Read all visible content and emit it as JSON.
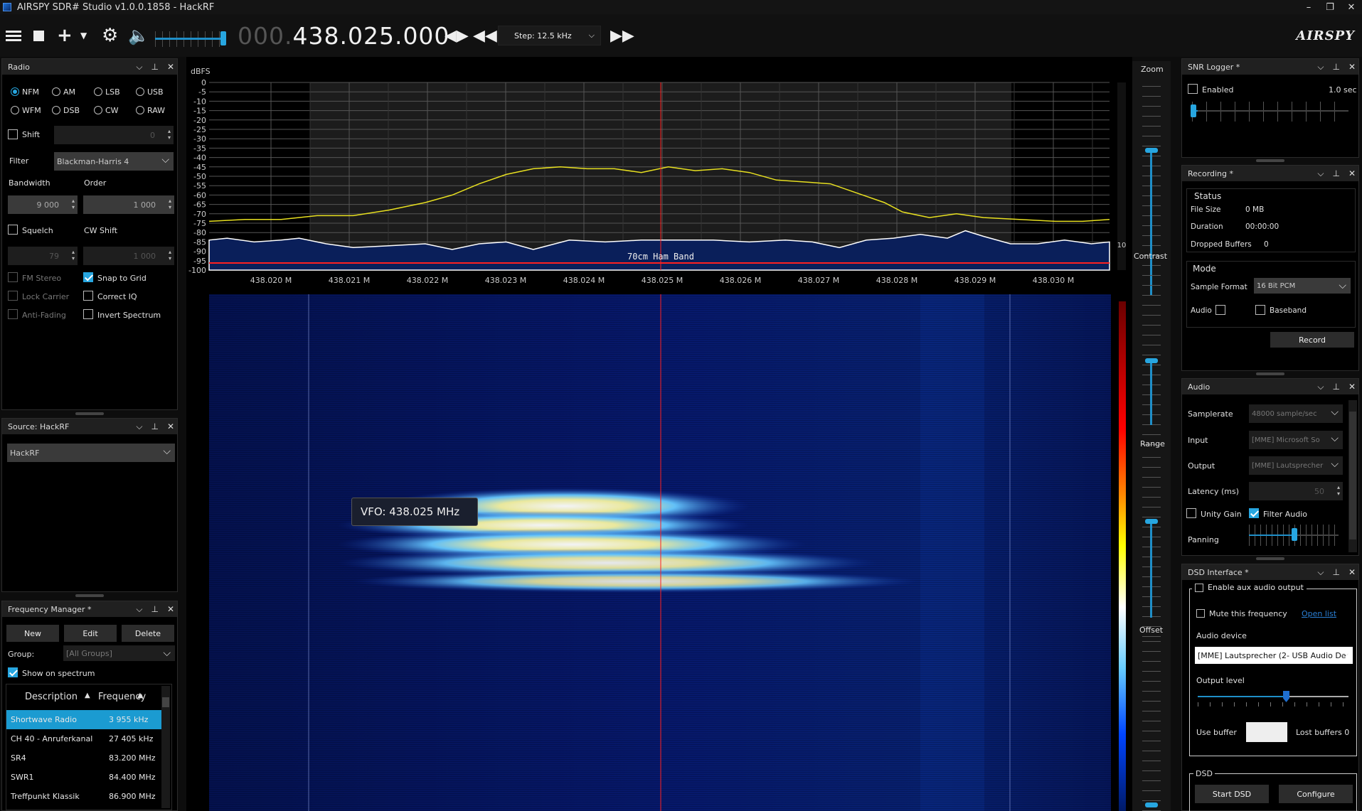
{
  "titlebar": {
    "title": "AIRSPY SDR# Studio v1.0.0.1858 - HackRF",
    "minimize": "–",
    "maximize": "❐",
    "close": "✕"
  },
  "toolbar": {
    "freq_dim": "000.",
    "freq_main": "438.025.000",
    "step_label": "Step: 12.5 kHz",
    "logo": "AIRSPY"
  },
  "radio": {
    "title": "Radio",
    "modes": [
      "NFM",
      "AM",
      "LSB",
      "USB",
      "WFM",
      "DSB",
      "CW",
      "RAW"
    ],
    "selected_mode": "NFM",
    "shift_label": "Shift",
    "shift_value": "0",
    "filter_label": "Filter",
    "filter_value": "Blackman-Harris 4",
    "bandwidth_label": "Bandwidth",
    "bandwidth_value": "9 000",
    "order_label": "Order",
    "order_value": "1 000",
    "squelch_label": "Squelch",
    "squelch_value": "79",
    "cwshift_label": "CW Shift",
    "cwshift_value": "1 000",
    "fm_stereo": "FM Stereo",
    "snap_to_grid": "Snap to Grid",
    "lock_carrier": "Lock Carrier",
    "correct_iq": "Correct IQ",
    "anti_fading": "Anti-Fading",
    "invert_spectrum": "Invert Spectrum"
  },
  "source": {
    "title": "Source: HackRF",
    "device": "HackRF"
  },
  "freqmgr": {
    "title": "Frequency Manager *",
    "new": "New",
    "edit": "Edit",
    "delete": "Delete",
    "group_label": "Group:",
    "group_value": "[All Groups]",
    "show_on_spectrum": "Show on spectrum",
    "col_desc": "Description",
    "col_freq": "Frequency",
    "rows": [
      {
        "desc": "Shortwave Radio",
        "freq": "3 955 kHz"
      },
      {
        "desc": "CH 40 - Anruferkanal",
        "freq": "27 405 kHz"
      },
      {
        "desc": "SR4",
        "freq": "83.200 MHz"
      },
      {
        "desc": "SWR1",
        "freq": "84.400 MHz"
      },
      {
        "desc": "Treffpunkt Klassik",
        "freq": "86.900 MHz"
      }
    ]
  },
  "spectrum": {
    "dbfs_label": "dBFS",
    "db_ticks": [
      "0",
      "-5",
      "-10",
      "-15",
      "-20",
      "-25",
      "-30",
      "-35",
      "-40",
      "-45",
      "-50",
      "-55",
      "-60",
      "-65",
      "-70",
      "-75",
      "-80",
      "-85",
      "-90",
      "-95",
      "-100"
    ],
    "freq_ticks": [
      "438.020 M",
      "438.021 M",
      "438.022 M",
      "438.023 M",
      "438.024 M",
      "438.025 M",
      "438.026 M",
      "438.027 M",
      "438.028 M",
      "438.029 M",
      "438.030 M"
    ],
    "band_label": "70cm Ham Band",
    "side_value": "10",
    "vfo_tooltip": "VFO: 438.025 MHz"
  },
  "zoomcol": {
    "zoom": "Zoom",
    "contrast": "Contrast",
    "range": "Range",
    "offset": "Offset"
  },
  "snr": {
    "title": "SNR Logger *",
    "enabled": "Enabled",
    "interval": "1.0 sec"
  },
  "recording": {
    "title": "Recording *",
    "status_group": "Status",
    "file_size_label": "File Size",
    "file_size": "0 MB",
    "duration_label": "Duration",
    "duration": "00:00:00",
    "dropped_label": "Dropped Buffers",
    "dropped": "0",
    "mode_group": "Mode",
    "sample_format_label": "Sample Format",
    "sample_format": "16 Bit PCM",
    "audio": "Audio",
    "baseband": "Baseband",
    "record": "Record"
  },
  "audio": {
    "title": "Audio",
    "samplerate_label": "Samplerate",
    "samplerate": "48000 sample/sec",
    "input_label": "Input",
    "input": "[MME] Microsoft So",
    "output_label": "Output",
    "output": "[MME] Lautsprecher",
    "latency_label": "Latency (ms)",
    "latency": "50",
    "unity_gain": "Unity Gain",
    "filter_audio": "Filter Audio",
    "panning": "Panning"
  },
  "dsd": {
    "title": "DSD Interface *",
    "enable_aux": "Enable aux audio output",
    "mute_freq": "Mute this frequency",
    "open_list": "Open list",
    "audio_device_label": "Audio device",
    "audio_device": "[MME] Lautsprecher (2- USB Audio De",
    "output_level": "Output level",
    "use_buffer": "Use buffer",
    "lost_buffers": "Lost buffers 0",
    "dsd_group": "DSD",
    "start": "Start DSD",
    "configure": "Configure"
  },
  "panel_controls": {
    "collapse": "⌵",
    "pin": "⊥",
    "close": "✕"
  },
  "colors": {
    "accent": "#27a6e0",
    "trace": "#e8e020",
    "marker": "#ff2020"
  }
}
